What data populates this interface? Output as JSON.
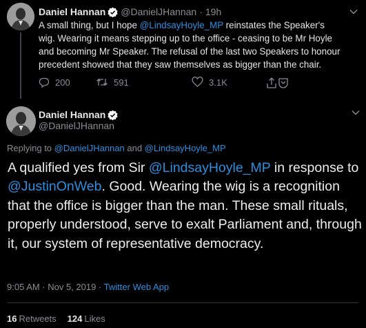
{
  "parent_tweet": {
    "author_name": "Daniel Hannan",
    "author_handle": "@DanielJHannan",
    "separator": "·",
    "time_ago": "19h",
    "text_before_mention": "A small thing, but I hope ",
    "mention": "@LindsayHoyle_MP",
    "text_after_mention": " reinstates the Speaker's wig. Wearing it means stepping up to the office - ceasing to be Mr Hoyle and becoming Mr Speaker. The refusal of the last two Speakers to honour precedent showed that they saw themselves as bigger than the chair.",
    "replies": "200",
    "retweets": "591",
    "likes": "3.1K"
  },
  "main_tweet": {
    "author_name": "Daniel Hannan",
    "author_handle": "@DanielJHannan",
    "replying_prefix": "Replying to ",
    "replying_to_1": "@DanielJHannan",
    "replying_and": " and ",
    "replying_to_2": "@LindsayHoyle_MP",
    "text_1": "A qualified yes from Sir ",
    "mention_1": "@LindsayHoyle_MP",
    "text_2": " in response to ",
    "mention_2": "@JustinOnWeb",
    "text_3": ". Good. Wearing the wig is a recognition that the office is bigger than the man. These small rituals, properly understood, serve to exalt Parliament and, through it, our system of representative democracy.",
    "time": "9:05 AM · Nov 5, 2019 · ",
    "source": "Twitter Web App",
    "retweet_count": "16",
    "retweet_label": "Retweets",
    "like_count": "124",
    "like_label": "Likes"
  },
  "icons": {
    "verified": "verified-badge-icon",
    "reply": "reply-icon",
    "retweet": "retweet-icon",
    "like": "heart-icon",
    "share": "share-icon",
    "menu": "chevron-down-icon"
  },
  "colors": {
    "background": "#000000",
    "link": "#2e8fe0",
    "muted": "#8a8d91",
    "text": "#e6e6e6",
    "verified": "#ffffff"
  }
}
